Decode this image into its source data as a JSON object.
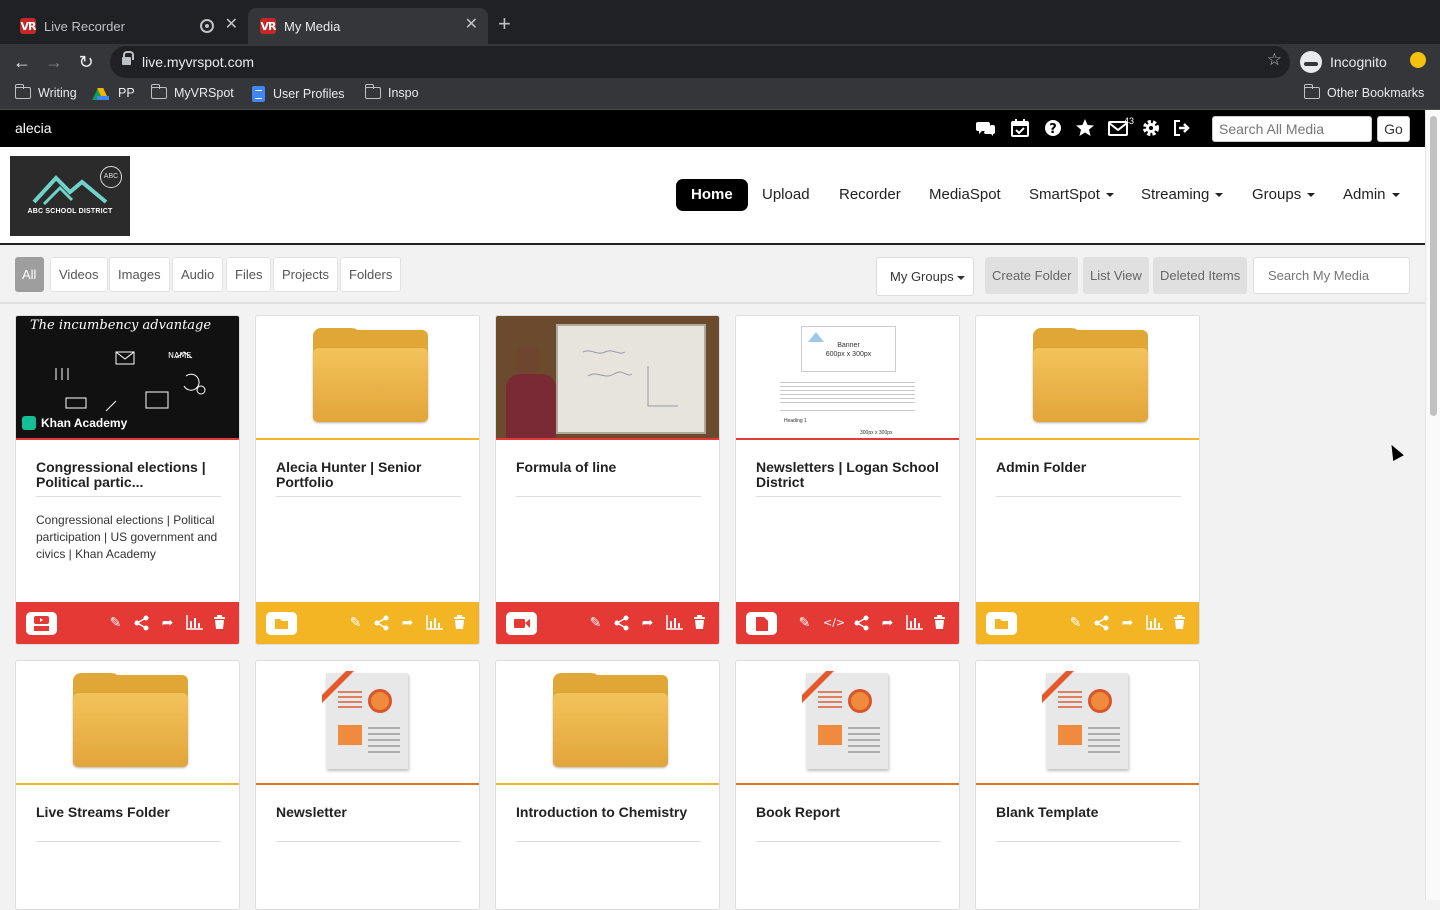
{
  "browser": {
    "tabs": [
      {
        "favicon": "VR",
        "title": "Live Recorder",
        "recording": true,
        "active": false
      },
      {
        "favicon": "VR",
        "title": "My Media",
        "active": true
      }
    ],
    "url": "live.myvrspot.com",
    "profile": "Incognito",
    "bookmarks": [
      "Writing",
      "PP",
      "MyVRSpot",
      "User Profiles",
      "Inspo"
    ],
    "other_bookmarks": "Other Bookmarks"
  },
  "app": {
    "username": "alecia",
    "mail_count": "43",
    "search_all_placeholder": "Search All Media",
    "go_label": "Go",
    "logo_badge": "ABC",
    "logo_text": "ABC SCHOOL DISTRICT",
    "nav": [
      "Home",
      "Upload",
      "Recorder",
      "MediaSpot",
      "SmartSpot",
      "Streaming",
      "Groups",
      "Admin"
    ],
    "filters": [
      "All",
      "Videos",
      "Images",
      "Audio",
      "Files",
      "Projects",
      "Folders"
    ],
    "my_groups": "My Groups",
    "create_folder": "Create Folder",
    "list_view": "List View",
    "deleted_items": "Deleted Items",
    "search_my_media_placeholder": "Search My Media"
  },
  "cards": [
    {
      "title": "Congressional elections | Political partic...",
      "description": "Congressional elections | Political participation | US government and civics | Khan Academy",
      "kind": "youtube",
      "color": "#e53935",
      "thumb": "khan",
      "thumb_title": "The incumbency advantage",
      "thumb_brand": "Khan Academy"
    },
    {
      "title": "Alecia Hunter | Senior Portfolio",
      "description": "",
      "kind": "folder",
      "color": "#f4b524",
      "thumb": "folder"
    },
    {
      "title": "Formula of line",
      "description": "",
      "kind": "video",
      "color": "#e53935",
      "thumb": "whiteboard"
    },
    {
      "title": "Newsletters | Logan School District",
      "description": "",
      "kind": "file",
      "color": "#e53935",
      "thumb": "newsletter",
      "thumb_banner": "Banner",
      "thumb_size": "600px x 300px",
      "thumb_heading": "Heading 1",
      "thumb_size2": "300px x 300px"
    },
    {
      "title": "Admin Folder",
      "description": "",
      "kind": "folder",
      "color": "#f4b524",
      "thumb": "folder"
    },
    {
      "title": "Live Streams Folder",
      "description": "",
      "kind": "folder",
      "color": "#f4b524",
      "thumb": "folder"
    },
    {
      "title": "Newsletter",
      "description": "",
      "kind": "project",
      "color": "#e8731f",
      "thumb": "doc"
    },
    {
      "title": "Introduction to Chemistry",
      "description": "",
      "kind": "folder",
      "color": "#f4b524",
      "thumb": "folder"
    },
    {
      "title": "Book Report",
      "description": "",
      "kind": "project",
      "color": "#e8731f",
      "thumb": "doc"
    },
    {
      "title": "Blank Template",
      "description": "",
      "kind": "project",
      "color": "#e8731f",
      "thumb": "doc"
    }
  ],
  "icons": {
    "chat": "chat-icon",
    "calendar": "calendar-icon",
    "help": "help-icon",
    "star": "star-icon",
    "mail": "mail-icon",
    "settings": "gear-icon",
    "logout": "logout-icon"
  }
}
